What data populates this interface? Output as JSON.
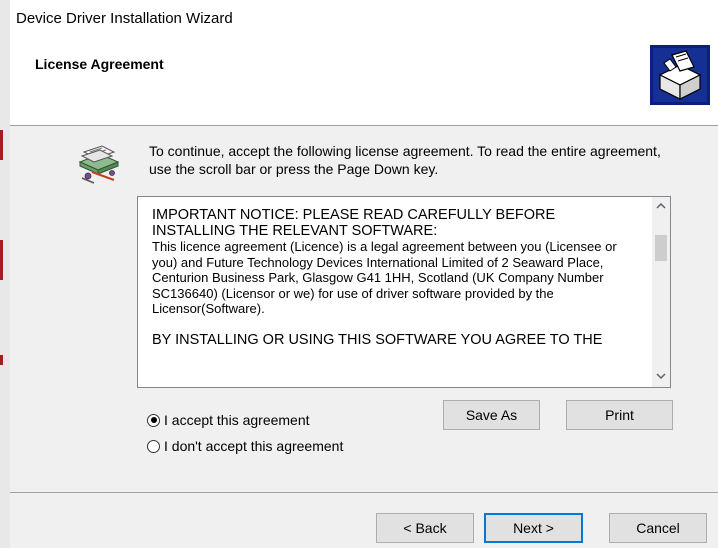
{
  "window": {
    "title": "Device Driver Installation Wizard"
  },
  "header": {
    "title": "License Agreement"
  },
  "intro_text": "To continue, accept the following license agreement. To read the entire agreement, use the scroll bar or press the Page Down key.",
  "license": {
    "notice": "IMPORTANT NOTICE: PLEASE READ CAREFULLY BEFORE INSTALLING THE RELEVANT SOFTWARE:",
    "body": "This licence agreement (Licence) is a legal agreement between you (Licensee or you) and Future Technology Devices International Limited of 2 Seaward Place, Centurion Business Park, Glasgow G41 1HH, Scotland (UK Company Number SC136640) (Licensor or we) for use of driver software provided by the Licensor(Software).",
    "tail": "BY INSTALLING OR USING THIS SOFTWARE YOU AGREE TO THE"
  },
  "options": {
    "accept": "I accept this agreement",
    "decline": "I don't accept this agreement",
    "selected": "accept"
  },
  "buttons": {
    "save_as": "Save As",
    "print": "Print",
    "back": "< Back",
    "next": "Next >",
    "cancel": "Cancel"
  },
  "icons": {
    "header": "installer-box-icon",
    "wizard": "license-document-icon"
  }
}
